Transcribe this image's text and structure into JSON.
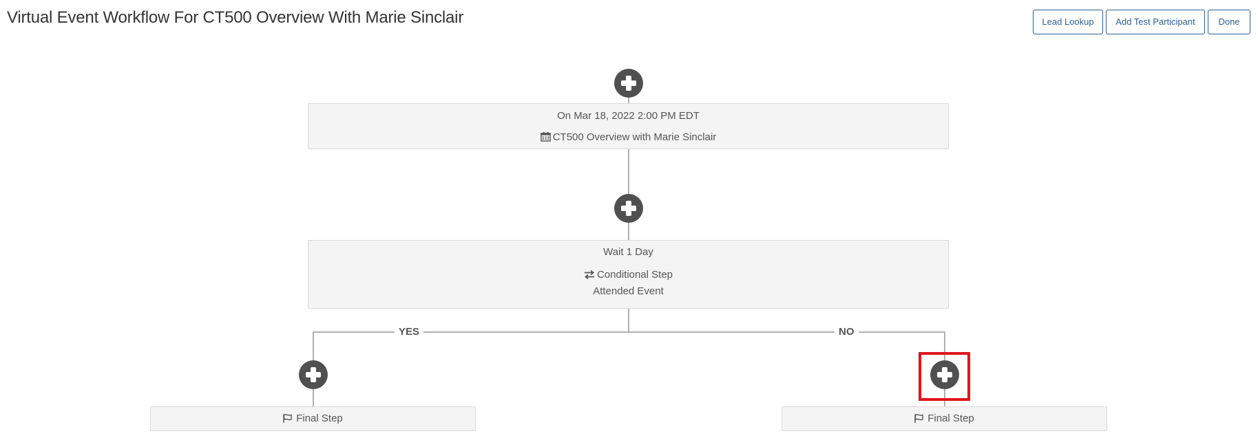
{
  "page": {
    "title": "Virtual Event Workflow For CT500 Overview With Marie Sinclair"
  },
  "toolbar": {
    "lead_lookup_label": "Lead Lookup",
    "add_test_participant_label": "Add Test Participant",
    "done_label": "Done",
    "accent_color": "#2d5f8f"
  },
  "workflow": {
    "trigger": {
      "date_text": "On Mar 18, 2022 2:00 PM EDT",
      "icon": "calendar-icon",
      "event_name": "CT500 Overview with Marie Sinclair"
    },
    "wait_step": {
      "wait_text": "Wait 1 Day",
      "icon": "exchange-arrows-icon",
      "step_type": "Conditional Step",
      "condition": "Attended Event"
    },
    "branches": {
      "yes_label": "YES",
      "no_label": "NO",
      "yes_final": {
        "icon": "flag-icon",
        "label": "Final Step"
      },
      "no_final": {
        "icon": "flag-icon",
        "label": "Final Step"
      }
    },
    "add_step_icon": "plus-circle-icon",
    "highlight_color": "#e0141e"
  }
}
